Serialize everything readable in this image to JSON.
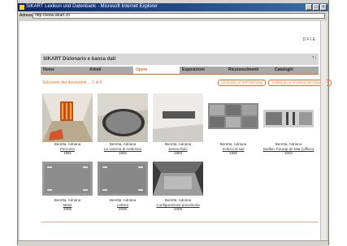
{
  "window": {
    "title": "SIKART Lexikon und Datenbank - Microsoft Internet Explorer",
    "address_label": "Adresse",
    "url": "http://www.sikart.ch"
  },
  "site": {
    "toplinks": "D  F  I  E",
    "brand": "SIKART Dizionario e banca dati",
    "header_icons": "? i",
    "tabs": [
      "Home",
      "Artisti",
      "Opere",
      "Esposizioni",
      "Riconoscimenti",
      "Cataloghi"
    ],
    "active_tab": "Opere",
    "results_text": "Selezione dei documenti ... 1 di 8",
    "buttons": [
      "LISTA DELLE ESPOSIZIONI",
      "TORNA ALLA SCHEDA INFORMATIVA"
    ]
  },
  "works": [
    {
      "artist": "Beretta, Adriana",
      "title": "Percorso",
      "year": "1991"
    },
    {
      "artist": "Beretta, Adriana",
      "title": "La cascina di Ambrosio",
      "year": "1992"
    },
    {
      "artist": "Beretta, Adriana",
      "title": "Senza titolo",
      "year": "1993"
    },
    {
      "artist": "Beretta, Adriana",
      "title": "Schizzi di sali",
      "year": "1996"
    },
    {
      "artist": "Beretta, Adriana",
      "title": "Sedlen, Feurap de Mar (Ufficio)",
      "year": "2002"
    },
    {
      "artist": "Beretta, Adriana",
      "title": "Mese",
      "year": "2005"
    },
    {
      "artist": "Beretta, Adriana",
      "title": "Lettera",
      "year": "2005"
    },
    {
      "artist": "Beretta, Adriana",
      "title": "Configurazione provvisoria",
      "year": "2005"
    }
  ],
  "colors": {
    "accent": "#f26a21",
    "titlebar": "#0a246a"
  }
}
